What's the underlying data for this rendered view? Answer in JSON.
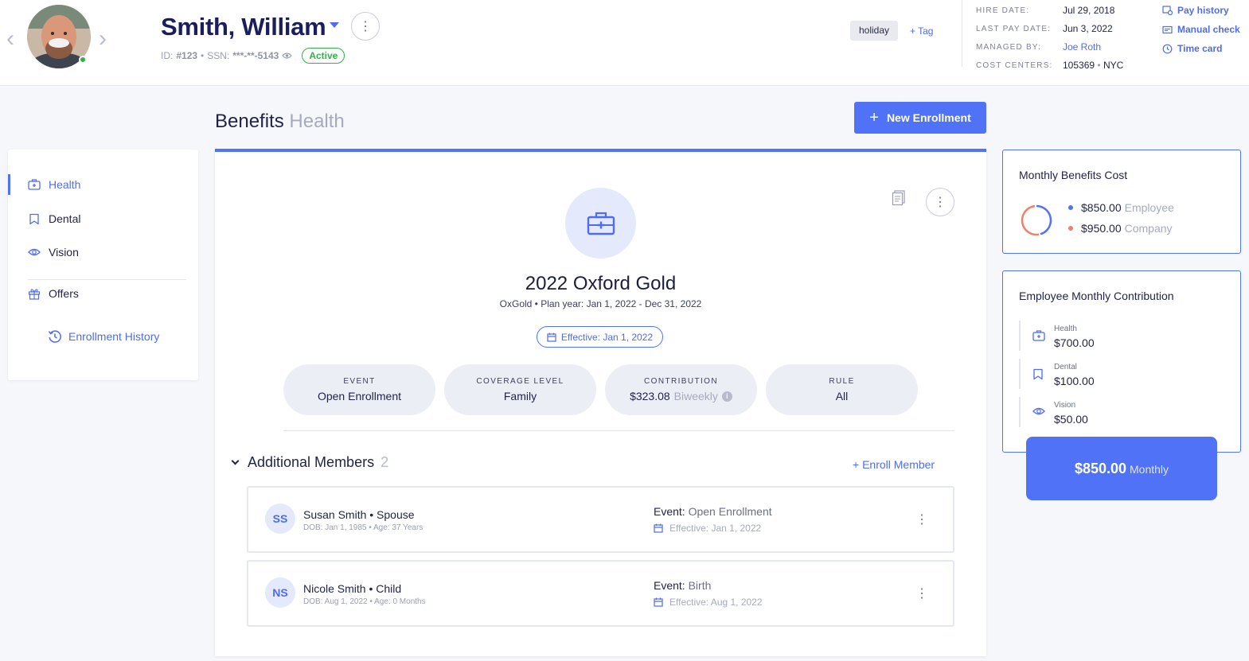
{
  "employee": {
    "name": "Smith, William",
    "id_label": "ID:",
    "id_value": "#123",
    "ssn_label": "SSN:",
    "ssn_value": "***-**-5143",
    "status": "Active",
    "tag": "holiday",
    "add_tag": "+ Tag"
  },
  "employment_info": {
    "hire_date_label": "HIRE DATE:",
    "hire_date": "Jul 29, 2018",
    "last_pay_label": "LAST PAY DATE:",
    "last_pay": "Jun 3, 2022",
    "managed_by_label": "MANAGED BY:",
    "managed_by": "Joe Roth",
    "cost_centers_label": "COST CENTERS:",
    "cost_center_code": "105369",
    "cost_center_location": "NYC"
  },
  "quick_links": [
    "Pay history",
    "Manual check",
    "Time card"
  ],
  "page": {
    "title": "Benefits",
    "subtitle": "Health",
    "new_enrollment": "New Enrollment"
  },
  "sidebar": {
    "items": [
      {
        "label": "Health",
        "icon": "first-aid-kit-icon",
        "active": true
      },
      {
        "label": "Dental",
        "icon": "tooth-icon",
        "active": false
      },
      {
        "label": "Vision",
        "icon": "eye-icon",
        "active": false
      },
      {
        "label": "Offers",
        "icon": "gift-icon",
        "active": false
      }
    ],
    "history": "Enrollment History"
  },
  "plan": {
    "name": "2022 Oxford Gold",
    "subtitle": "OxGold • Plan year: Jan 1, 2022 - Dec 31, 2022",
    "effective": "Effective: Jan 1, 2022",
    "stats": [
      {
        "label": "EVENT",
        "value": "Open Enrollment"
      },
      {
        "label": "COVERAGE LEVEL",
        "value": "Family"
      },
      {
        "label": "CONTRIBUTION",
        "value": "$323.08",
        "suffix": "Biweekly"
      },
      {
        "label": "RULE",
        "value": "All"
      }
    ]
  },
  "members": {
    "title": "Additional Members",
    "count": "2",
    "enroll": "+ Enroll Member",
    "list": [
      {
        "initials": "SS",
        "name": "Susan Smith • Spouse",
        "dob": "DOB: Jan 1, 1985 • Age: 37 Years",
        "event_label": "Event:",
        "event": "Open Enrollment",
        "effective": "Effective: Jan 1, 2022"
      },
      {
        "initials": "NS",
        "name": "Nicole Smith • Child",
        "dob": "DOB: Aug 1, 2022 • Age: 0 Months",
        "event_label": "Event:",
        "event": "Birth",
        "effective": "Effective: Aug 1, 2022"
      }
    ]
  },
  "monthly_cost": {
    "title": "Monthly Benefits Cost",
    "employee_amount": "$850.00",
    "employee_label": "Employee",
    "company_amount": "$950.00",
    "company_label": "Company",
    "employee_value": 850,
    "company_value": 950,
    "employee_color": "#4f72f6",
    "company_color": "#f0806a"
  },
  "contribution": {
    "title": "Employee Monthly Contribution",
    "rows": [
      {
        "label": "Health",
        "value": "$700.00",
        "icon": "first-aid-kit-icon"
      },
      {
        "label": "Dental",
        "value": "$100.00",
        "icon": "tooth-icon"
      },
      {
        "label": "Vision",
        "value": "$50.00",
        "icon": "eye-icon"
      }
    ],
    "total": "$850.00",
    "period": "Monthly"
  },
  "colors": {
    "accent": "#4f72f6",
    "active_green": "#2fb344",
    "navy": "#1b1e5c"
  }
}
